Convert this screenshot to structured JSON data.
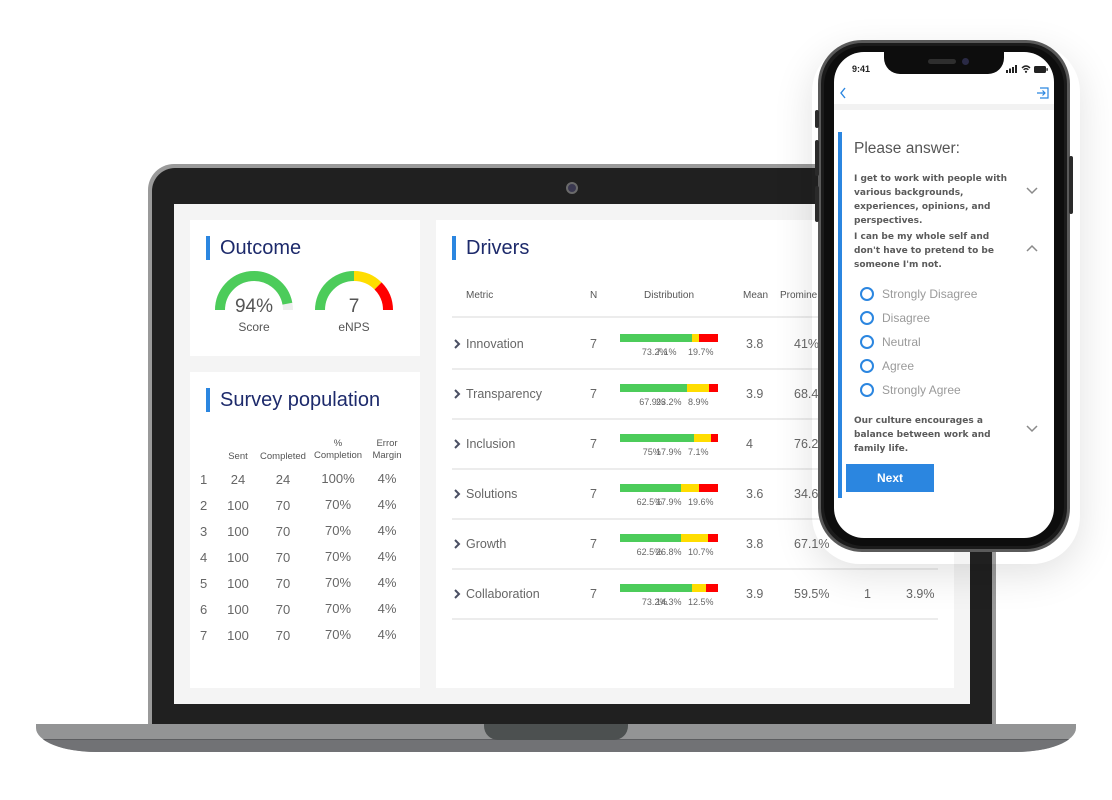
{
  "outcome": {
    "title": "Outcome",
    "score": {
      "value": "94%",
      "label": "Score",
      "fraction": 0.94
    },
    "enps": {
      "value": "7",
      "label": "eNPS"
    }
  },
  "survey_population": {
    "title": "Survey population",
    "headers": [
      "",
      "Sent",
      "Completed",
      "%\nCompletion",
      "Error\nMargin"
    ],
    "rows": [
      [
        "1",
        "24",
        "24",
        "100%",
        "4%"
      ],
      [
        "2",
        "100",
        "70",
        "70%",
        "4%"
      ],
      [
        "3",
        "100",
        "70",
        "70%",
        "4%"
      ],
      [
        "4",
        "100",
        "70",
        "70%",
        "4%"
      ],
      [
        "5",
        "100",
        "70",
        "70%",
        "4%"
      ],
      [
        "6",
        "100",
        "70",
        "70%",
        "4%"
      ],
      [
        "7",
        "100",
        "70",
        "70%",
        "4%"
      ]
    ]
  },
  "drivers": {
    "title": "Drivers",
    "headers": {
      "metric": "Metric",
      "n": "N",
      "distribution": "Distribution",
      "mean": "Mean",
      "prominence": "Promine"
    },
    "rows": [
      {
        "metric": "Innovation",
        "n": "7",
        "dist": [
          73.2,
          7.1,
          19.7
        ],
        "labels": [
          "73.2%",
          "7.1%",
          "19.7%"
        ],
        "mean": "3.8",
        "prominence": "41%",
        "c6": "",
        "c7": ""
      },
      {
        "metric": "Transparency",
        "n": "7",
        "dist": [
          67.9,
          23.2,
          8.9
        ],
        "labels": [
          "67.9%",
          "23.2%",
          "8.9%"
        ],
        "mean": "3.9",
        "prominence": "68.4%",
        "c6": "",
        "c7": ""
      },
      {
        "metric": "Inclusion",
        "n": "7",
        "dist": [
          75,
          17.9,
          7.1
        ],
        "labels": [
          "75%",
          "17.9%",
          "7.1%"
        ],
        "mean": "4",
        "prominence": "76.2%",
        "c6": "",
        "c7": ""
      },
      {
        "metric": "Solutions",
        "n": "7",
        "dist": [
          62.5,
          17.9,
          19.6
        ],
        "labels": [
          "62.5%",
          "17.9%",
          "19.6%"
        ],
        "mean": "3.6",
        "prominence": "34.6%",
        "c6": "",
        "c7": ""
      },
      {
        "metric": "Growth",
        "n": "7",
        "dist": [
          62.5,
          26.8,
          10.7
        ],
        "labels": [
          "62.5%",
          "26.8%",
          "10.7%"
        ],
        "mean": "3.8",
        "prominence": "67.1%",
        "c6": "",
        "c7": ""
      },
      {
        "metric": "Collaboration",
        "n": "7",
        "dist": [
          73.2,
          14.3,
          12.5
        ],
        "labels": [
          "73.2%",
          "14.3%",
          "12.5%"
        ],
        "mean": "3.9",
        "prominence": "59.5%",
        "c6": "1",
        "c7": "3.9%"
      }
    ]
  },
  "phone": {
    "time": "9:41",
    "prompt": "Please answer:",
    "questions": [
      {
        "text": "I get to work with people with various backgrounds, experiences, opinions, and perspectives.",
        "expanded": false
      },
      {
        "text": "I can be my whole self and don't have to pretend to be someone I'm not.",
        "expanded": true
      },
      {
        "text": "Our culture encourages a balance between work and family life.",
        "expanded": false
      }
    ],
    "options": [
      "Strongly Disagree",
      "Disagree",
      "Neutral",
      "Agree",
      "Strongly Agree"
    ],
    "next_label": "Next"
  },
  "colors": {
    "accent": "#2b86e0",
    "title": "#1d2a6b",
    "positive": "#4ccc5a",
    "neutral": "#ffdd00",
    "negative": "#ff0000"
  }
}
